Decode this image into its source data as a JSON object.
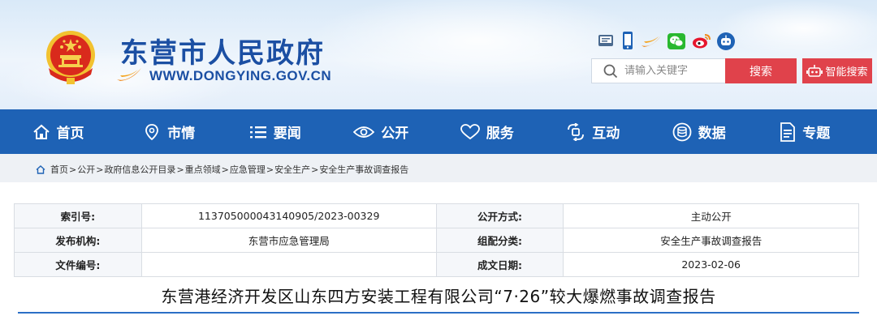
{
  "header": {
    "site_title": "东营市人民政府",
    "site_url": "WWW.DONGYING.GOV.CN",
    "social_icons": [
      "mobile-site-icon",
      "phone-icon",
      "app-swoosh-icon",
      "wechat-icon",
      "weibo-icon",
      "robot-icon"
    ],
    "search": {
      "placeholder": "请输入关键字",
      "button_label": "搜索",
      "smart_label": "智能搜索"
    }
  },
  "nav": {
    "items": [
      {
        "label": "首页",
        "icon": "home-icon"
      },
      {
        "label": "市情",
        "icon": "map-pin-icon"
      },
      {
        "label": "要闻",
        "icon": "list-icon"
      },
      {
        "label": "公开",
        "icon": "eye-icon"
      },
      {
        "label": "服务",
        "icon": "heart-icon"
      },
      {
        "label": "互动",
        "icon": "interaction-icon"
      },
      {
        "label": "数据",
        "icon": "data-icon"
      },
      {
        "label": "专题",
        "icon": "document-icon"
      }
    ]
  },
  "breadcrumb": [
    "首页",
    "公开",
    "政府信息公开目录",
    "重点领域",
    "应急管理",
    "安全生产",
    "安全生产事故调查报告"
  ],
  "info": {
    "index_label": "索引号:",
    "index_value": "113705000043140905/2023-00329",
    "open_method_label": "公开方式:",
    "open_method_value": "主动公开",
    "publisher_label": "发布机构:",
    "publisher_value": "东营市应急管理局",
    "category_label": "组配分类:",
    "category_value": "安全生产事故调查报告",
    "doc_no_label": "文件编号:",
    "doc_no_value": "",
    "date_label": "成文日期:",
    "date_value": "2023-02-06"
  },
  "document": {
    "title": "东营港经济开发区山东四方安装工程有限公司“7·26”较大爆燃事故调查报告"
  },
  "colors": {
    "nav_blue": "#1e62b5",
    "brand_blue": "#1b4fa3",
    "search_red": "#e0424b"
  }
}
